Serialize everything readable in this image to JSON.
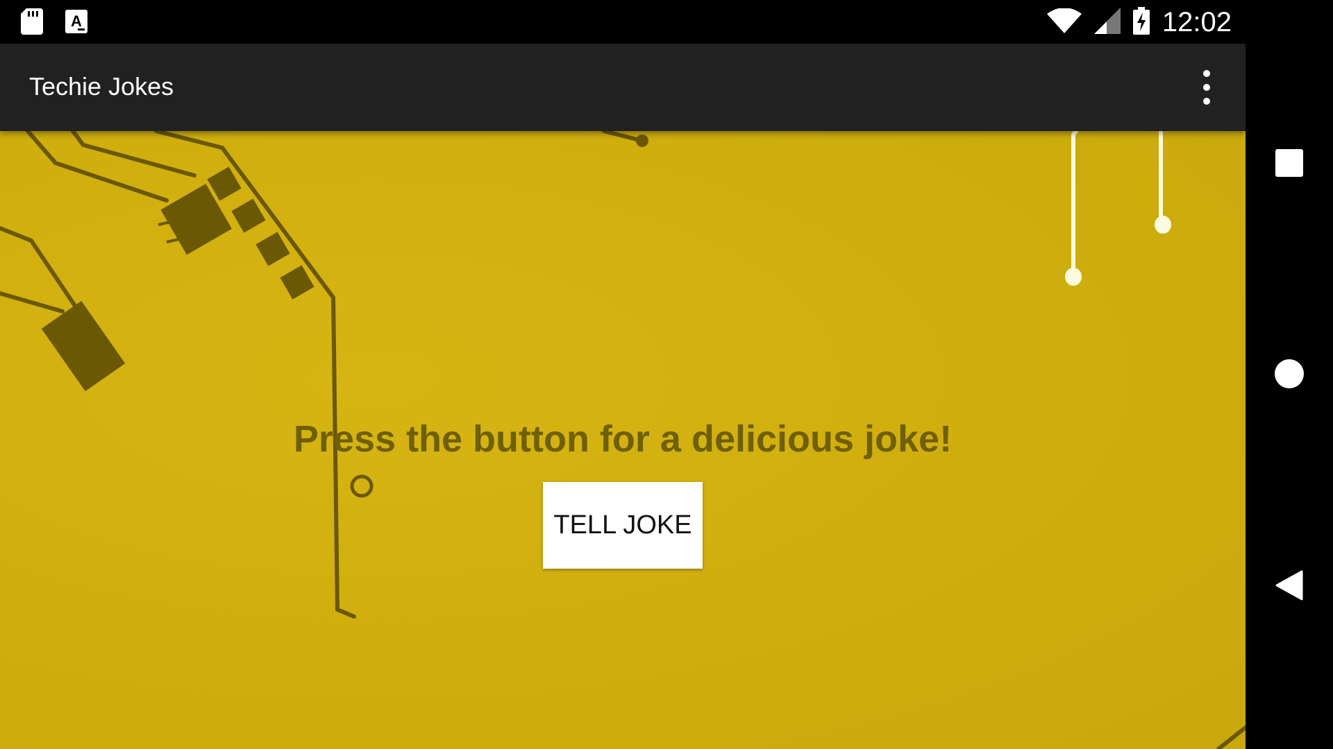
{
  "status_bar": {
    "time": "12:02",
    "left_icons": [
      "sd-card-icon",
      "text-a-icon"
    ],
    "right_icons": [
      "wifi-icon",
      "cell-signal-icon",
      "battery-charging-icon"
    ]
  },
  "app_bar": {
    "title": "Techie Jokes",
    "menu_icon": "more-vertical-icon"
  },
  "main": {
    "prompt": "Press the button for a delicious joke!",
    "button_label": "TELL JOKE",
    "background_color": "#cfae0e",
    "text_color": "#6f5f05"
  },
  "nav_bar": {
    "buttons": [
      "recents-icon",
      "home-icon",
      "back-icon"
    ]
  }
}
